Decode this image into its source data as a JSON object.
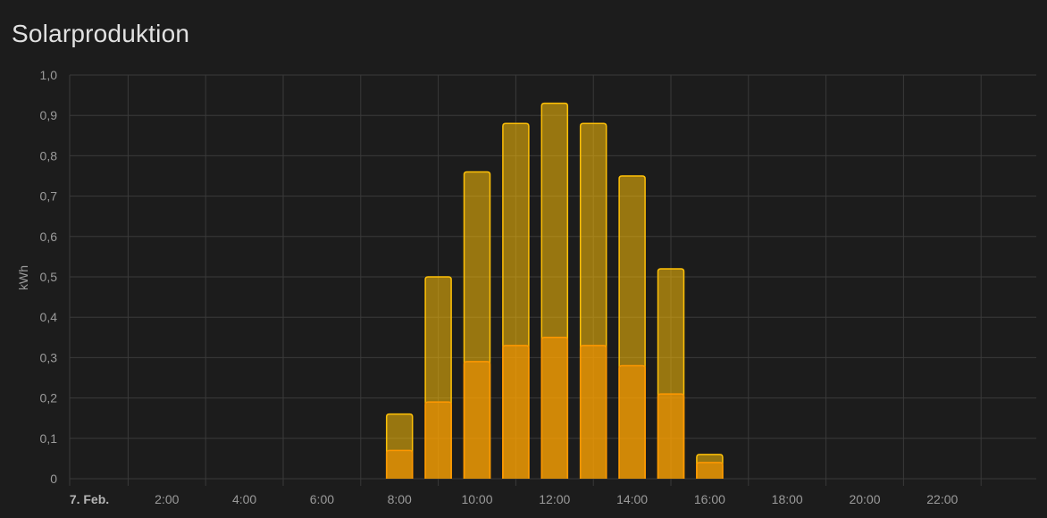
{
  "card": {
    "title": "Solarproduktion"
  },
  "chart_data": {
    "type": "bar",
    "title": "Solarproduktion",
    "xlabel": "",
    "ylabel": "kWh",
    "ylim": [
      0,
      1.0
    ],
    "yticks": [
      "0",
      "0,1",
      "0,2",
      "0,3",
      "0,4",
      "0,5",
      "0,6",
      "0,7",
      "0,8",
      "0,9",
      "1,0"
    ],
    "xticks": [
      "7. Feb.",
      "2:00",
      "4:00",
      "6:00",
      "8:00",
      "10:00",
      "12:00",
      "14:00",
      "16:00",
      "18:00",
      "20:00",
      "22:00"
    ],
    "x_hours": [
      8,
      9,
      10,
      11,
      12,
      13,
      14,
      15,
      16
    ],
    "series": [
      {
        "values": [
          0.16,
          0.5,
          0.76,
          0.88,
          0.93,
          0.88,
          0.75,
          0.52,
          0.06
        ],
        "color": "#ffc107"
      },
      {
        "values": [
          0.07,
          0.19,
          0.29,
          0.33,
          0.35,
          0.33,
          0.28,
          0.21,
          0.04
        ],
        "color": "#ff9800"
      }
    ],
    "grid": true,
    "legend": "none",
    "colors": {
      "background": "#1c1c1c",
      "grid": "#3a3a3a"
    }
  }
}
